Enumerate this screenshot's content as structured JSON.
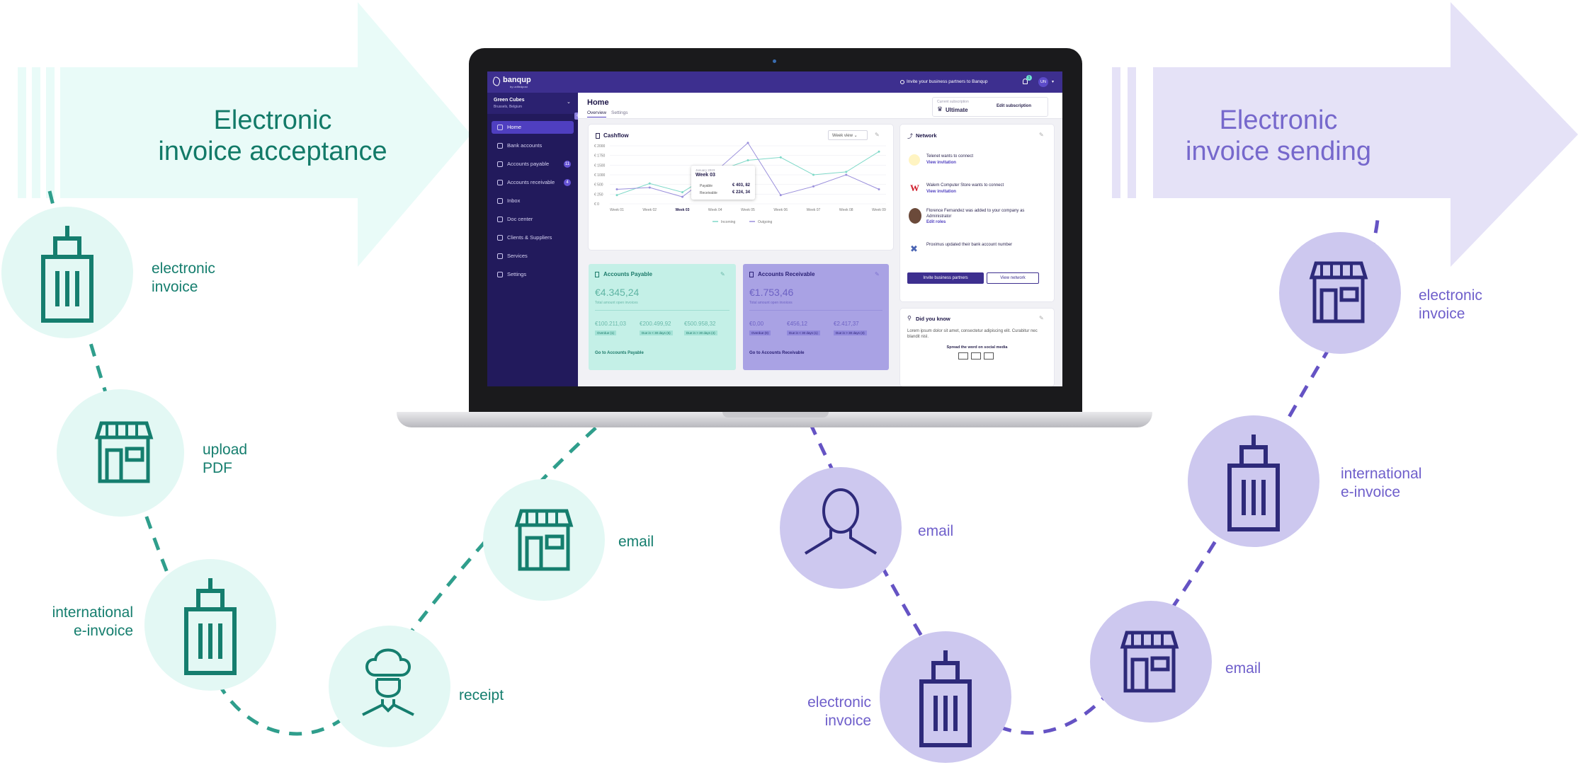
{
  "left_flow": {
    "title": "Electronic\ninvoice acceptance",
    "color": "#127a68",
    "circle_color": "#e3f8f4",
    "nodes": [
      {
        "icon": "office-building-icon",
        "label": "electronic\ninvoice"
      },
      {
        "icon": "storefront-icon",
        "label": "upload\nPDF"
      },
      {
        "icon": "office-building-icon",
        "label": "international\ne-invoice"
      },
      {
        "icon": "chef-person-icon",
        "label": "receipt"
      },
      {
        "icon": "storefront-icon",
        "label": "email"
      }
    ]
  },
  "right_flow": {
    "title": "Electronic\ninvoice sending",
    "color": "#6f5fcb",
    "circle_color": "#cdc8ef",
    "nodes": [
      {
        "icon": "person-icon",
        "label": "email"
      },
      {
        "icon": "office-building-icon",
        "label": "electronic\ninvoice"
      },
      {
        "icon": "storefront-icon",
        "label": "email"
      },
      {
        "icon": "office-building-icon",
        "label": "international\ne-invoice"
      },
      {
        "icon": "storefront-icon",
        "label": "electronic\ninvoice"
      }
    ]
  },
  "app": {
    "brand": "banqup",
    "brand_sub": "by unifiedpost",
    "invite_text": "Invite your business partners to Banqup",
    "user_initials": "UN",
    "notification_count": "1",
    "company_name": "Green Cubes",
    "company_location": "Brussels, Belgium",
    "nav": [
      {
        "label": "Home",
        "active": true,
        "badge": ""
      },
      {
        "label": "Bank accounts",
        "active": false,
        "badge": ""
      },
      {
        "label": "Accounts payable",
        "active": false,
        "badge": "11"
      },
      {
        "label": "Accounts receivable",
        "active": false,
        "badge": "4"
      },
      {
        "label": "Inbox",
        "active": false,
        "badge": ""
      },
      {
        "label": "Doc center",
        "active": false,
        "badge": ""
      },
      {
        "label": "Clients & Suppliers",
        "active": false,
        "badge": ""
      },
      {
        "label": "Services",
        "active": false,
        "badge": ""
      },
      {
        "label": "Settings",
        "active": false,
        "badge": ""
      }
    ],
    "page_title": "Home",
    "tabs": [
      "Overview",
      "Settings"
    ],
    "subscription_caption": "Current subscription",
    "subscription_name": "Ultimate",
    "edit_subscription": "Edit subscription",
    "cashflow": {
      "title": "Cashflow",
      "view_select": "Week view",
      "y_ticks": [
        "€ 2000",
        "€ 1750",
        "€ 1500",
        "€ 1000",
        "€ 500",
        "€ 250",
        "€ 0"
      ],
      "x_ticks": [
        "Week 01",
        "Week 02",
        "Week 03",
        "Week 04",
        "Week 05",
        "Week 06",
        "Week 07",
        "Week 08",
        "Week 09"
      ],
      "legend": [
        "Incoming",
        "Outgoing"
      ],
      "tooltip": {
        "caption": "January 2023",
        "week": "Week 03",
        "rows": [
          {
            "label": "Payable",
            "value": "€ 403, 82"
          },
          {
            "label": "Receivable",
            "value": "€ 224, 34"
          }
        ]
      }
    },
    "network": {
      "title": "Network",
      "items": [
        {
          "text": "Telenet wants to connect",
          "link": "View invitation"
        },
        {
          "text": "Walem Computer Store wants to connect",
          "link": "View invitation"
        },
        {
          "text": "Florence Fernandez was added to your company as Administrator",
          "link": "Edit roles"
        },
        {
          "text": "Proximus updated their bank account number",
          "link": ""
        }
      ],
      "invite_button": "Invite business partners",
      "view_button": "View network"
    },
    "payable": {
      "title": "Accounts Payable",
      "total": "€4.345,24",
      "total_caption": "Total amount open invoices",
      "amounts": [
        "€100.211,03",
        "€200.499,92",
        "€500.958,32"
      ],
      "tags": [
        "Overdue (1)",
        "Due in < 30 days (5)",
        "Due in > 30 days (4)"
      ],
      "link": "Go to Accounts Payable"
    },
    "receivable": {
      "title": "Accounts Receivable",
      "total": "€1.753,46",
      "total_caption": "Total amount open invoices",
      "amounts": [
        "€0,00",
        "€456,12",
        "€2.417,37"
      ],
      "tags": [
        "Overdue (0)",
        "Due in < 30 days (1)",
        "Due in > 30 days (3)"
      ],
      "link": "Go to Accounts Receivable"
    },
    "did_you_know": {
      "title": "Did you know",
      "text": "Lorem ipsum dolor sit amet, consectetur adipiscing elit. Curabitur nec blandit nisl.",
      "share": "Spread the word on social media"
    }
  }
}
